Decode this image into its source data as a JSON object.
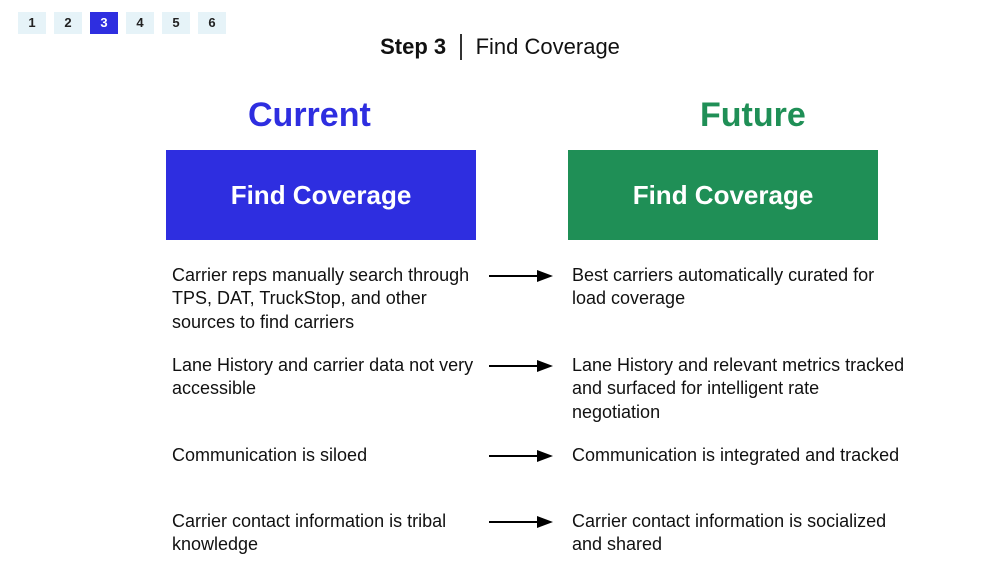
{
  "pager": {
    "steps": [
      "1",
      "2",
      "3",
      "4",
      "5",
      "6"
    ],
    "active_index": 2
  },
  "title": {
    "bold": "Step 3",
    "label": "Find Coverage"
  },
  "columns": {
    "current_header": "Current",
    "future_header": "Future",
    "current_banner": "Find Coverage",
    "future_banner": "Find Coverage"
  },
  "colors": {
    "current": "#2e2ee0",
    "future": "#1f8f56",
    "pager_bg": "#e6f3f8"
  },
  "rows": [
    {
      "current": "Carrier reps manually search through TPS, DAT, TruckStop, and other sources to find carriers",
      "future": "Best carriers automatically curated for load coverage"
    },
    {
      "current": "Lane History and carrier data not very accessible",
      "future": "Lane History and relevant metrics tracked and surfaced for intelligent rate negotiation"
    },
    {
      "current": "Communication is siloed",
      "future": "Communication is integrated and tracked"
    },
    {
      "current": "Carrier contact information is tribal knowledge",
      "future": "Carrier contact information is socialized and shared"
    }
  ]
}
